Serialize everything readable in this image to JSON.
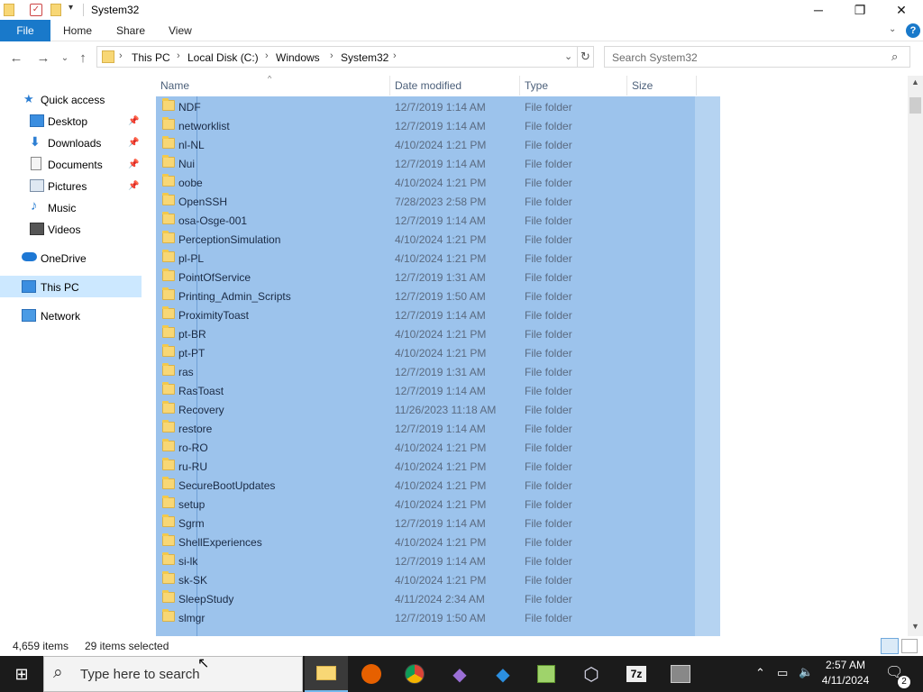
{
  "window": {
    "title": "System32",
    "minimize_icon": "minimize-icon",
    "maximize_icon": "maximize-icon",
    "close_icon": "close-icon"
  },
  "ribbon": {
    "tabs": [
      "File",
      "Home",
      "Share",
      "View"
    ]
  },
  "address": {
    "crumbs": [
      "This PC",
      "Local Disk (C:)",
      "Windows",
      "System32"
    ],
    "search_placeholder": "Search System32"
  },
  "nav": {
    "items": [
      {
        "label": "Quick access",
        "icon": "star-icon",
        "pinned": false
      },
      {
        "label": "Desktop",
        "icon": "desktop-icon",
        "pinned": true
      },
      {
        "label": "Downloads",
        "icon": "download-icon",
        "pinned": true
      },
      {
        "label": "Documents",
        "icon": "document-icon",
        "pinned": true
      },
      {
        "label": "Pictures",
        "icon": "pictures-icon",
        "pinned": true
      },
      {
        "label": "Music",
        "icon": "music-icon",
        "pinned": false
      },
      {
        "label": "Videos",
        "icon": "video-icon",
        "pinned": false
      },
      {
        "label": "OneDrive",
        "icon": "cloud-icon",
        "pinned": false
      },
      {
        "label": "This PC",
        "icon": "computer-icon",
        "pinned": false
      },
      {
        "label": "Network",
        "icon": "network-icon",
        "pinned": false
      }
    ],
    "selected": "This PC"
  },
  "columns": [
    "Name",
    "Date modified",
    "Type",
    "Size"
  ],
  "files": [
    {
      "name": "NDF",
      "date": "12/7/2019 1:14 AM",
      "type": "File folder"
    },
    {
      "name": "networklist",
      "date": "12/7/2019 1:14 AM",
      "type": "File folder"
    },
    {
      "name": "nl-NL",
      "date": "4/10/2024 1:21 PM",
      "type": "File folder"
    },
    {
      "name": "Nui",
      "date": "12/7/2019 1:14 AM",
      "type": "File folder"
    },
    {
      "name": "oobe",
      "date": "4/10/2024 1:21 PM",
      "type": "File folder"
    },
    {
      "name": "OpenSSH",
      "date": "7/28/2023 2:58 PM",
      "type": "File folder"
    },
    {
      "name": "osa-Osge-001",
      "date": "12/7/2019 1:14 AM",
      "type": "File folder"
    },
    {
      "name": "PerceptionSimulation",
      "date": "4/10/2024 1:21 PM",
      "type": "File folder"
    },
    {
      "name": "pl-PL",
      "date": "4/10/2024 1:21 PM",
      "type": "File folder"
    },
    {
      "name": "PointOfService",
      "date": "12/7/2019 1:31 AM",
      "type": "File folder"
    },
    {
      "name": "Printing_Admin_Scripts",
      "date": "12/7/2019 1:50 AM",
      "type": "File folder"
    },
    {
      "name": "ProximityToast",
      "date": "12/7/2019 1:14 AM",
      "type": "File folder"
    },
    {
      "name": "pt-BR",
      "date": "4/10/2024 1:21 PM",
      "type": "File folder"
    },
    {
      "name": "pt-PT",
      "date": "4/10/2024 1:21 PM",
      "type": "File folder"
    },
    {
      "name": "ras",
      "date": "12/7/2019 1:31 AM",
      "type": "File folder"
    },
    {
      "name": "RasToast",
      "date": "12/7/2019 1:14 AM",
      "type": "File folder"
    },
    {
      "name": "Recovery",
      "date": "11/26/2023 11:18 AM",
      "type": "File folder"
    },
    {
      "name": "restore",
      "date": "12/7/2019 1:14 AM",
      "type": "File folder"
    },
    {
      "name": "ro-RO",
      "date": "4/10/2024 1:21 PM",
      "type": "File folder"
    },
    {
      "name": "ru-RU",
      "date": "4/10/2024 1:21 PM",
      "type": "File folder"
    },
    {
      "name": "SecureBootUpdates",
      "date": "4/10/2024 1:21 PM",
      "type": "File folder"
    },
    {
      "name": "setup",
      "date": "4/10/2024 1:21 PM",
      "type": "File folder"
    },
    {
      "name": "Sgrm",
      "date": "12/7/2019 1:14 AM",
      "type": "File folder"
    },
    {
      "name": "ShellExperiences",
      "date": "4/10/2024 1:21 PM",
      "type": "File folder"
    },
    {
      "name": "si-lk",
      "date": "12/7/2019 1:14 AM",
      "type": "File folder"
    },
    {
      "name": "sk-SK",
      "date": "4/10/2024 1:21 PM",
      "type": "File folder"
    },
    {
      "name": "SleepStudy",
      "date": "4/11/2024 2:34 AM",
      "type": "File folder"
    },
    {
      "name": "slmgr",
      "date": "12/7/2019 1:50 AM",
      "type": "File folder"
    }
  ],
  "status": {
    "item_count": "4,659 items",
    "selected_count": "29 items selected"
  },
  "taskbar": {
    "search_placeholder": "Type here to search",
    "apps": [
      "file-explorer-icon",
      "firefox-icon",
      "chrome-icon",
      "visual-studio-icon",
      "vscode-icon",
      "notepad-plus-icon",
      "virtualbox-icon",
      "7zip-icon",
      "terminal-icon"
    ],
    "time": "2:57 AM",
    "date": "4/11/2024",
    "notification_count": "2"
  },
  "colors": {
    "accent": "#1979ca",
    "selection": "#9cc3ec",
    "taskbar": "#1b1b1b"
  }
}
